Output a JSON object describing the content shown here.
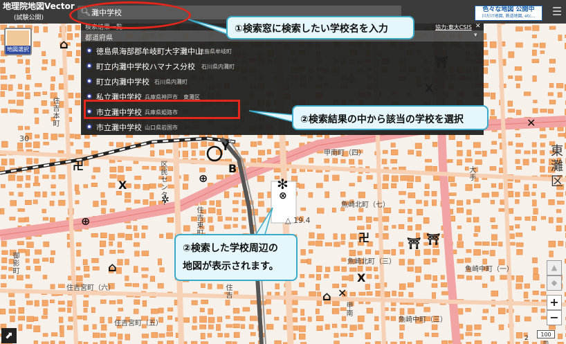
{
  "app": {
    "title": "地理院地図Vector",
    "subtitle": "(試験公開)",
    "menu_glyph": "☰"
  },
  "search": {
    "value": "灘中学校",
    "icon": "search-icon"
  },
  "brand": {
    "title": "色々な地図 公開中",
    "subtitle": "川だけ地図, 鉄道地図, etc..."
  },
  "results": {
    "header_left": "検索結果一覧",
    "credit": "協力:東大CSIS",
    "close_glyph": "✕",
    "group_label": "都道府県",
    "group_toggle_glyph": "▾",
    "items": [
      {
        "name": "徳島県海部郡牟岐町大字灘中山",
        "location": "徳島県牟岐町"
      },
      {
        "name": "町立内灘中学校ハマナス分校",
        "location": "石川県内灘町"
      },
      {
        "name": "町立内灘中学校",
        "location": "石川県内灘町"
      },
      {
        "name": "私立灘中学校",
        "location": "兵庫県神戸市　東灘区"
      },
      {
        "name": "市立灘中学校",
        "location": "兵庫県姫路市"
      },
      {
        "name": "市立灘中学校",
        "location": "山口県岩国市"
      }
    ]
  },
  "map_select": {
    "label": "地図選択"
  },
  "callouts": {
    "step1": "①検索窓に検索したい学校名を入力",
    "step2": "②検索結果の中から該当の学校を選択",
    "step3_line1": "②検索した学校周辺の",
    "step3_line2": "地図が表示されます。"
  },
  "map_labels": {
    "east_nada": "東灘区",
    "elevation": "△ 19.4",
    "number_30": "30",
    "kou_minami": "甲南町（四）",
    "uozaki_kita_7": "魚崎北町（七）",
    "uozaki_kita_3": "魚崎北町（三）",
    "uozaki_naka_1": "魚崎中町（一）",
    "uozaki_naka_3": "魚崎中町（三）",
    "sumiyoshi_miya_6": "住吉宮町（六）",
    "sumiyoshi_miya_5": "住吉宮町（五）",
    "sumiyoshi_hon": "住吉本町",
    "sumiyoshi_higashi": "住吉東町",
    "ku_center": "区民センター",
    "mikage": "御影町",
    "sumiyoshi_vert": "住吉",
    "kou_minami_vert": "甲南",
    "osakae": "大手",
    "number_2": "2"
  },
  "controls": {
    "zoom_in": "+",
    "zoom_out": "−",
    "tilt_up": "▲",
    "tilt_mid": "◆",
    "scale": "100 m",
    "corner_glyph": "⬈"
  }
}
